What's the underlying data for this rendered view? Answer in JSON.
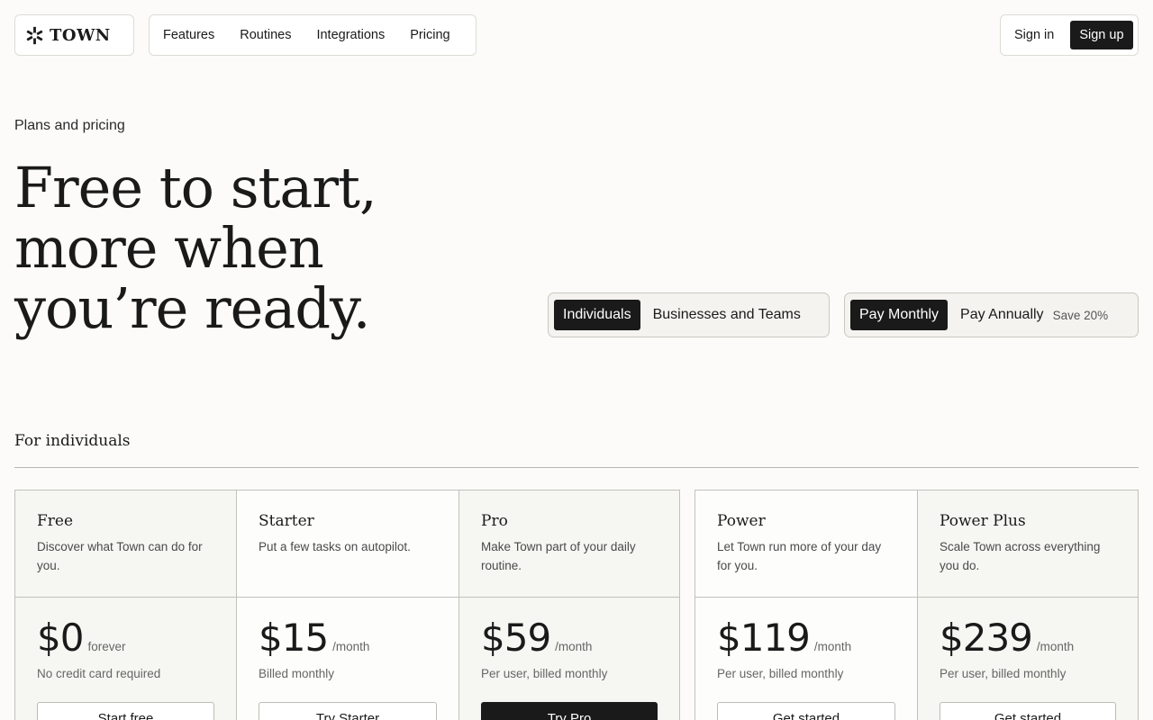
{
  "brand": {
    "name": "TOWN",
    "logo_icon": "asterisk-star-icon"
  },
  "nav": {
    "items": [
      "Features",
      "Routines",
      "Integrations",
      "Pricing"
    ]
  },
  "auth": {
    "signin_label": "Sign in",
    "signup_label": "Sign up"
  },
  "hero": {
    "eyebrow": "Plans and pricing",
    "title_lines": [
      "Free to start,",
      "more when",
      "you’re ready."
    ]
  },
  "audience_toggle": {
    "options": [
      "Individuals",
      "Businesses and Teams"
    ],
    "selected": "Individuals"
  },
  "billing_toggle": {
    "options": [
      "Pay Monthly",
      "Pay Annually"
    ],
    "selected": "Pay Monthly",
    "annual_badge": "Save 20%"
  },
  "section": {
    "title": "For individuals"
  },
  "plans": [
    {
      "name": "Free",
      "desc": "Discover what Town can do for you.",
      "price": "$0",
      "period": "forever",
      "note": "No credit card required",
      "cta": "Start free"
    },
    {
      "name": "Starter",
      "desc": "Put a few tasks on autopilot.",
      "price": "$15",
      "period": "/month",
      "note": "Billed monthly",
      "cta": "Try Starter"
    },
    {
      "name": "Pro",
      "desc": "Make Town part of your daily routine.",
      "price": "$59",
      "period": "/month",
      "note": "Per user, billed monthly",
      "cta": "Try Pro"
    },
    {
      "name": "Power",
      "desc": "Let Town run more of your day for you.",
      "price": "$119",
      "period": "/month",
      "note": "Per user, billed monthly",
      "cta": "Get started"
    },
    {
      "name": "Power Plus",
      "desc": "Scale Town across everything you do.",
      "price": "$239",
      "period": "/month",
      "note": "Per user, billed monthly",
      "cta": "Get started"
    }
  ],
  "colors": {
    "ink": "#1a1a1a",
    "background": "#fcfbfa",
    "card_shade": "#f6f6f2",
    "border": "#c2c2bb"
  }
}
